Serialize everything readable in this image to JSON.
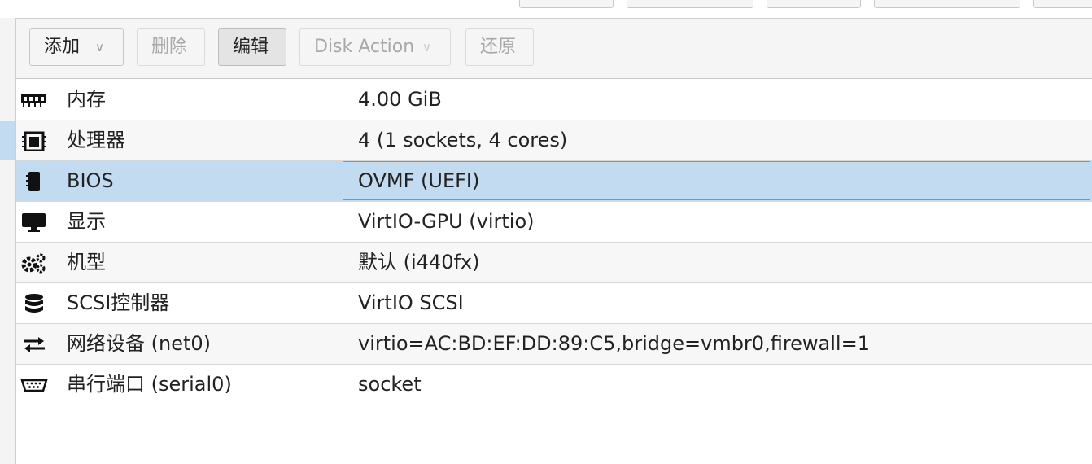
{
  "toolbar": {
    "add_label": "添加",
    "delete_label": "删除",
    "edit_label": "编辑",
    "disk_action_label": "Disk Action",
    "revert_label": "还原"
  },
  "hardware": {
    "rows": [
      {
        "icon": "memory-icon",
        "name": "内存",
        "value": "4.00 GiB"
      },
      {
        "icon": "cpu-icon",
        "name": "处理器",
        "value": "4 (1 sockets, 4 cores)"
      },
      {
        "icon": "bios-chip-icon",
        "name": "BIOS",
        "value": "OVMF (UEFI)"
      },
      {
        "icon": "monitor-icon",
        "name": "显示",
        "value": "VirtIO-GPU (virtio)"
      },
      {
        "icon": "gears-icon",
        "name": "机型",
        "value": "默认 (i440fx)"
      },
      {
        "icon": "database-icon",
        "name": "SCSI控制器",
        "value": "VirtIO SCSI"
      },
      {
        "icon": "exchange-arrows-icon",
        "name": "网络设备 (net0)",
        "value": "virtio=AC:BD:EF:DD:89:C5,bridge=vmbr0,firewall=1"
      },
      {
        "icon": "serial-port-icon",
        "name": "串行端口 (serial0)",
        "value": "socket"
      }
    ],
    "selected_index": 2
  },
  "colors": {
    "selection": "#c2dbf0",
    "focus_border": "#5aa0d8",
    "toolbar_bg": "#f5f5f5"
  }
}
